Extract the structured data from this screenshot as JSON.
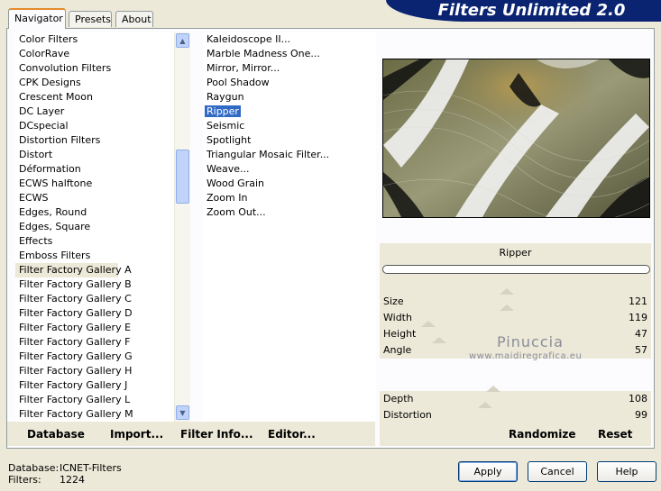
{
  "app_title": "Filters Unlimited 2.0",
  "tabs": [
    "Navigator",
    "Presets",
    "About"
  ],
  "categories": [
    "Color Filters",
    "ColorRave",
    "Convolution Filters",
    "CPK Designs",
    "Crescent Moon",
    "DC Layer",
    "DCspecial",
    "Distortion Filters",
    "Distort",
    "Déformation",
    "ECWS halftone",
    "ECWS",
    "Edges, Round",
    "Edges, Square",
    "Effects",
    "Emboss Filters",
    "Filter Factory Gallery A",
    "Filter Factory Gallery B",
    "Filter Factory Gallery C",
    "Filter Factory Gallery D",
    "Filter Factory Gallery E",
    "Filter Factory Gallery F",
    "Filter Factory Gallery G",
    "Filter Factory Gallery H",
    "Filter Factory Gallery J",
    "Filter Factory Gallery L",
    "Filter Factory Gallery M"
  ],
  "selected_category": "Filter Factory Gallery A",
  "filters": [
    "Kaleidoscope II...",
    "Marble Madness One...",
    "Mirror, Mirror...",
    "Pool Shadow",
    "Raygun",
    "Ripper",
    "Seismic",
    "Spotlight",
    "Triangular Mosaic Filter...",
    "Weave...",
    "Wood Grain",
    "Zoom In",
    "Zoom Out..."
  ],
  "selected_filter": "Ripper",
  "filter_name": "Ripper",
  "params": [
    {
      "label": "Size",
      "value": "121",
      "level": 0.47
    },
    {
      "label": "Width",
      "value": "119",
      "level": 0.47
    },
    {
      "label": "Height",
      "value": "47",
      "level": 0.18
    },
    {
      "label": "Angle",
      "value": "57",
      "level": 0.22
    },
    {
      "label": "",
      "value": "",
      "level": null
    },
    {
      "label": "",
      "value": "",
      "level": null
    },
    {
      "label": "Depth",
      "value": "108",
      "level": 0.42
    },
    {
      "label": "Distortion",
      "value": "99",
      "level": 0.39
    }
  ],
  "bottom_buttons": {
    "database": "Database",
    "import": "Import...",
    "filter_info": "Filter Info...",
    "editor": "Editor...",
    "randomize": "Randomize",
    "reset": "Reset"
  },
  "status": {
    "database_label": "Database:",
    "database_value": "ICNET-Filters",
    "filters_label": "Filters:",
    "filters_value": "1224"
  },
  "dialog_buttons": {
    "apply": "Apply",
    "cancel": "Cancel",
    "help": "Help"
  },
  "watermark": {
    "name": "Pinuccia",
    "url": "www.maidiregrafica.eu"
  },
  "colors": {
    "banner": "#0a2472",
    "selection": "#316ac5",
    "tab_accent": "#e68b2c"
  }
}
